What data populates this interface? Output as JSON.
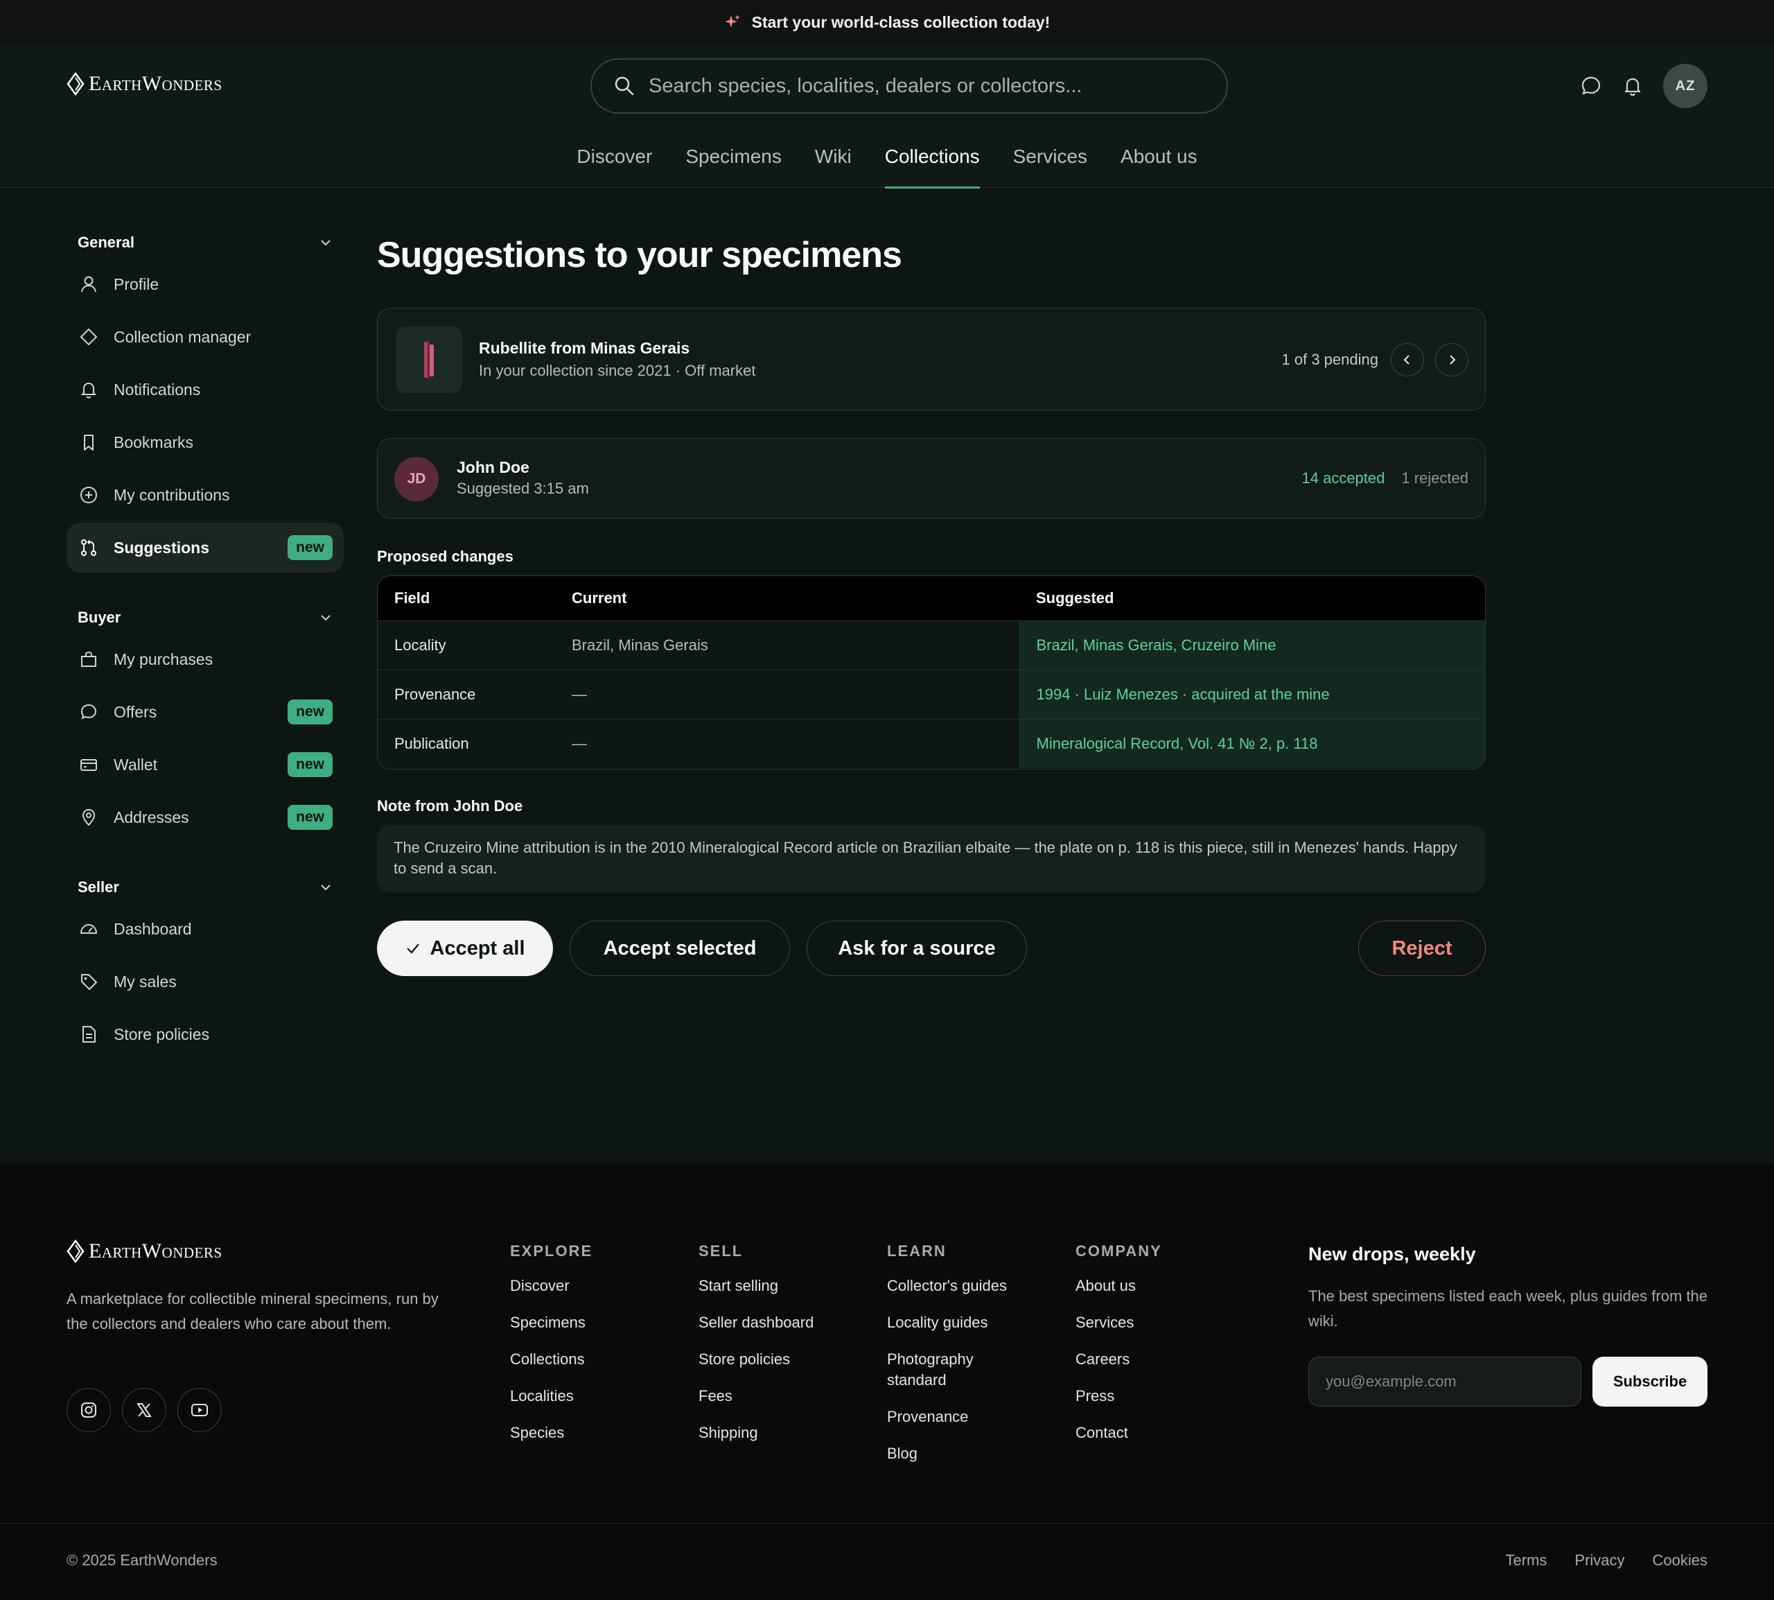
{
  "promo": {
    "text": "Start your world-class collection today!"
  },
  "header": {
    "logo": "EarthWonders",
    "search_placeholder": "Search species, localities, dealers or collectors...",
    "avatar_initials": "AZ",
    "nav": [
      "Discover",
      "Specimens",
      "Wiki",
      "Collections",
      "Services",
      "About us"
    ],
    "active_nav": "Collections"
  },
  "sidebar": {
    "general": {
      "label": "General",
      "items": [
        "Profile",
        "Collection manager",
        "Notifications",
        "Bookmarks",
        "My contributions",
        "Suggestions"
      ],
      "suggestions_badge": "new"
    },
    "buyer": {
      "label": "Buyer",
      "items": [
        "My purchases",
        "Offers",
        "Wallet",
        "Addresses"
      ],
      "badge": "new"
    },
    "seller": {
      "label": "Seller",
      "items": [
        "Dashboard",
        "My sales",
        "Store policies"
      ]
    }
  },
  "main": {
    "title": "Suggestions to your specimens",
    "specimen": {
      "name": "Rubellite from Minas Gerais",
      "meta": "In your collection since 2021 · Off market",
      "pending": "1 of 3 pending"
    },
    "suggester": {
      "initials": "JD",
      "name": "John Doe",
      "time": "Suggested 3:15 am",
      "accepted": "14 accepted",
      "rejected": "1 rejected"
    },
    "changes_label": "Proposed changes",
    "table": {
      "headers": [
        "Field",
        "Current",
        "Suggested"
      ],
      "rows": [
        [
          "Locality",
          "Brazil, Minas Gerais",
          "Brazil, Minas Gerais, Cruzeiro Mine"
        ],
        [
          "Provenance",
          "—",
          "1994 · Luiz Menezes · acquired at the mine"
        ],
        [
          "Publication",
          "—",
          "Mineralogical Record, Vol. 41 № 2, p. 118"
        ]
      ]
    },
    "note_label": "Note from John Doe",
    "note": "The Cruzeiro Mine attribution is in the 2010 Mineralogical Record article on Brazilian elbaite — the plate on p. 118 is this piece, still in Menezes' hands. Happy to send a scan.",
    "buttons": {
      "accept_all": "Accept all",
      "accept_selected": "Accept selected",
      "ask_source": "Ask for a source",
      "reject": "Reject"
    }
  },
  "footer": {
    "logo": "EarthWonders",
    "tagline": "A marketplace for collectible mineral specimens, run by the collectors and dealers who care about them.",
    "columns": [
      {
        "title": "EXPLORE",
        "links": [
          "Discover",
          "Specimens",
          "Collections",
          "Localities",
          "Species"
        ]
      },
      {
        "title": "SELL",
        "links": [
          "Start selling",
          "Seller dashboard",
          "Store policies",
          "Fees",
          "Shipping"
        ]
      },
      {
        "title": "LEARN",
        "links": [
          "Collector's guides",
          "Locality guides",
          "Photography standard",
          "Provenance",
          "Blog"
        ]
      },
      {
        "title": "COMPANY",
        "links": [
          "About us",
          "Services",
          "Careers",
          "Press",
          "Contact"
        ]
      }
    ],
    "newsletter": {
      "title": "New drops, weekly",
      "text": "The best specimens listed each week, plus guides from the wiki.",
      "placeholder": "you@example.com",
      "button": "Subscribe"
    },
    "copyright": "© 2025 EarthWonders",
    "legal": [
      "Terms",
      "Privacy",
      "Cookies"
    ]
  },
  "colors": {
    "accent": "#3fae83",
    "suggested_text": "#5fcf9f",
    "reject": "#f08a7c",
    "background": "#0d1612"
  }
}
